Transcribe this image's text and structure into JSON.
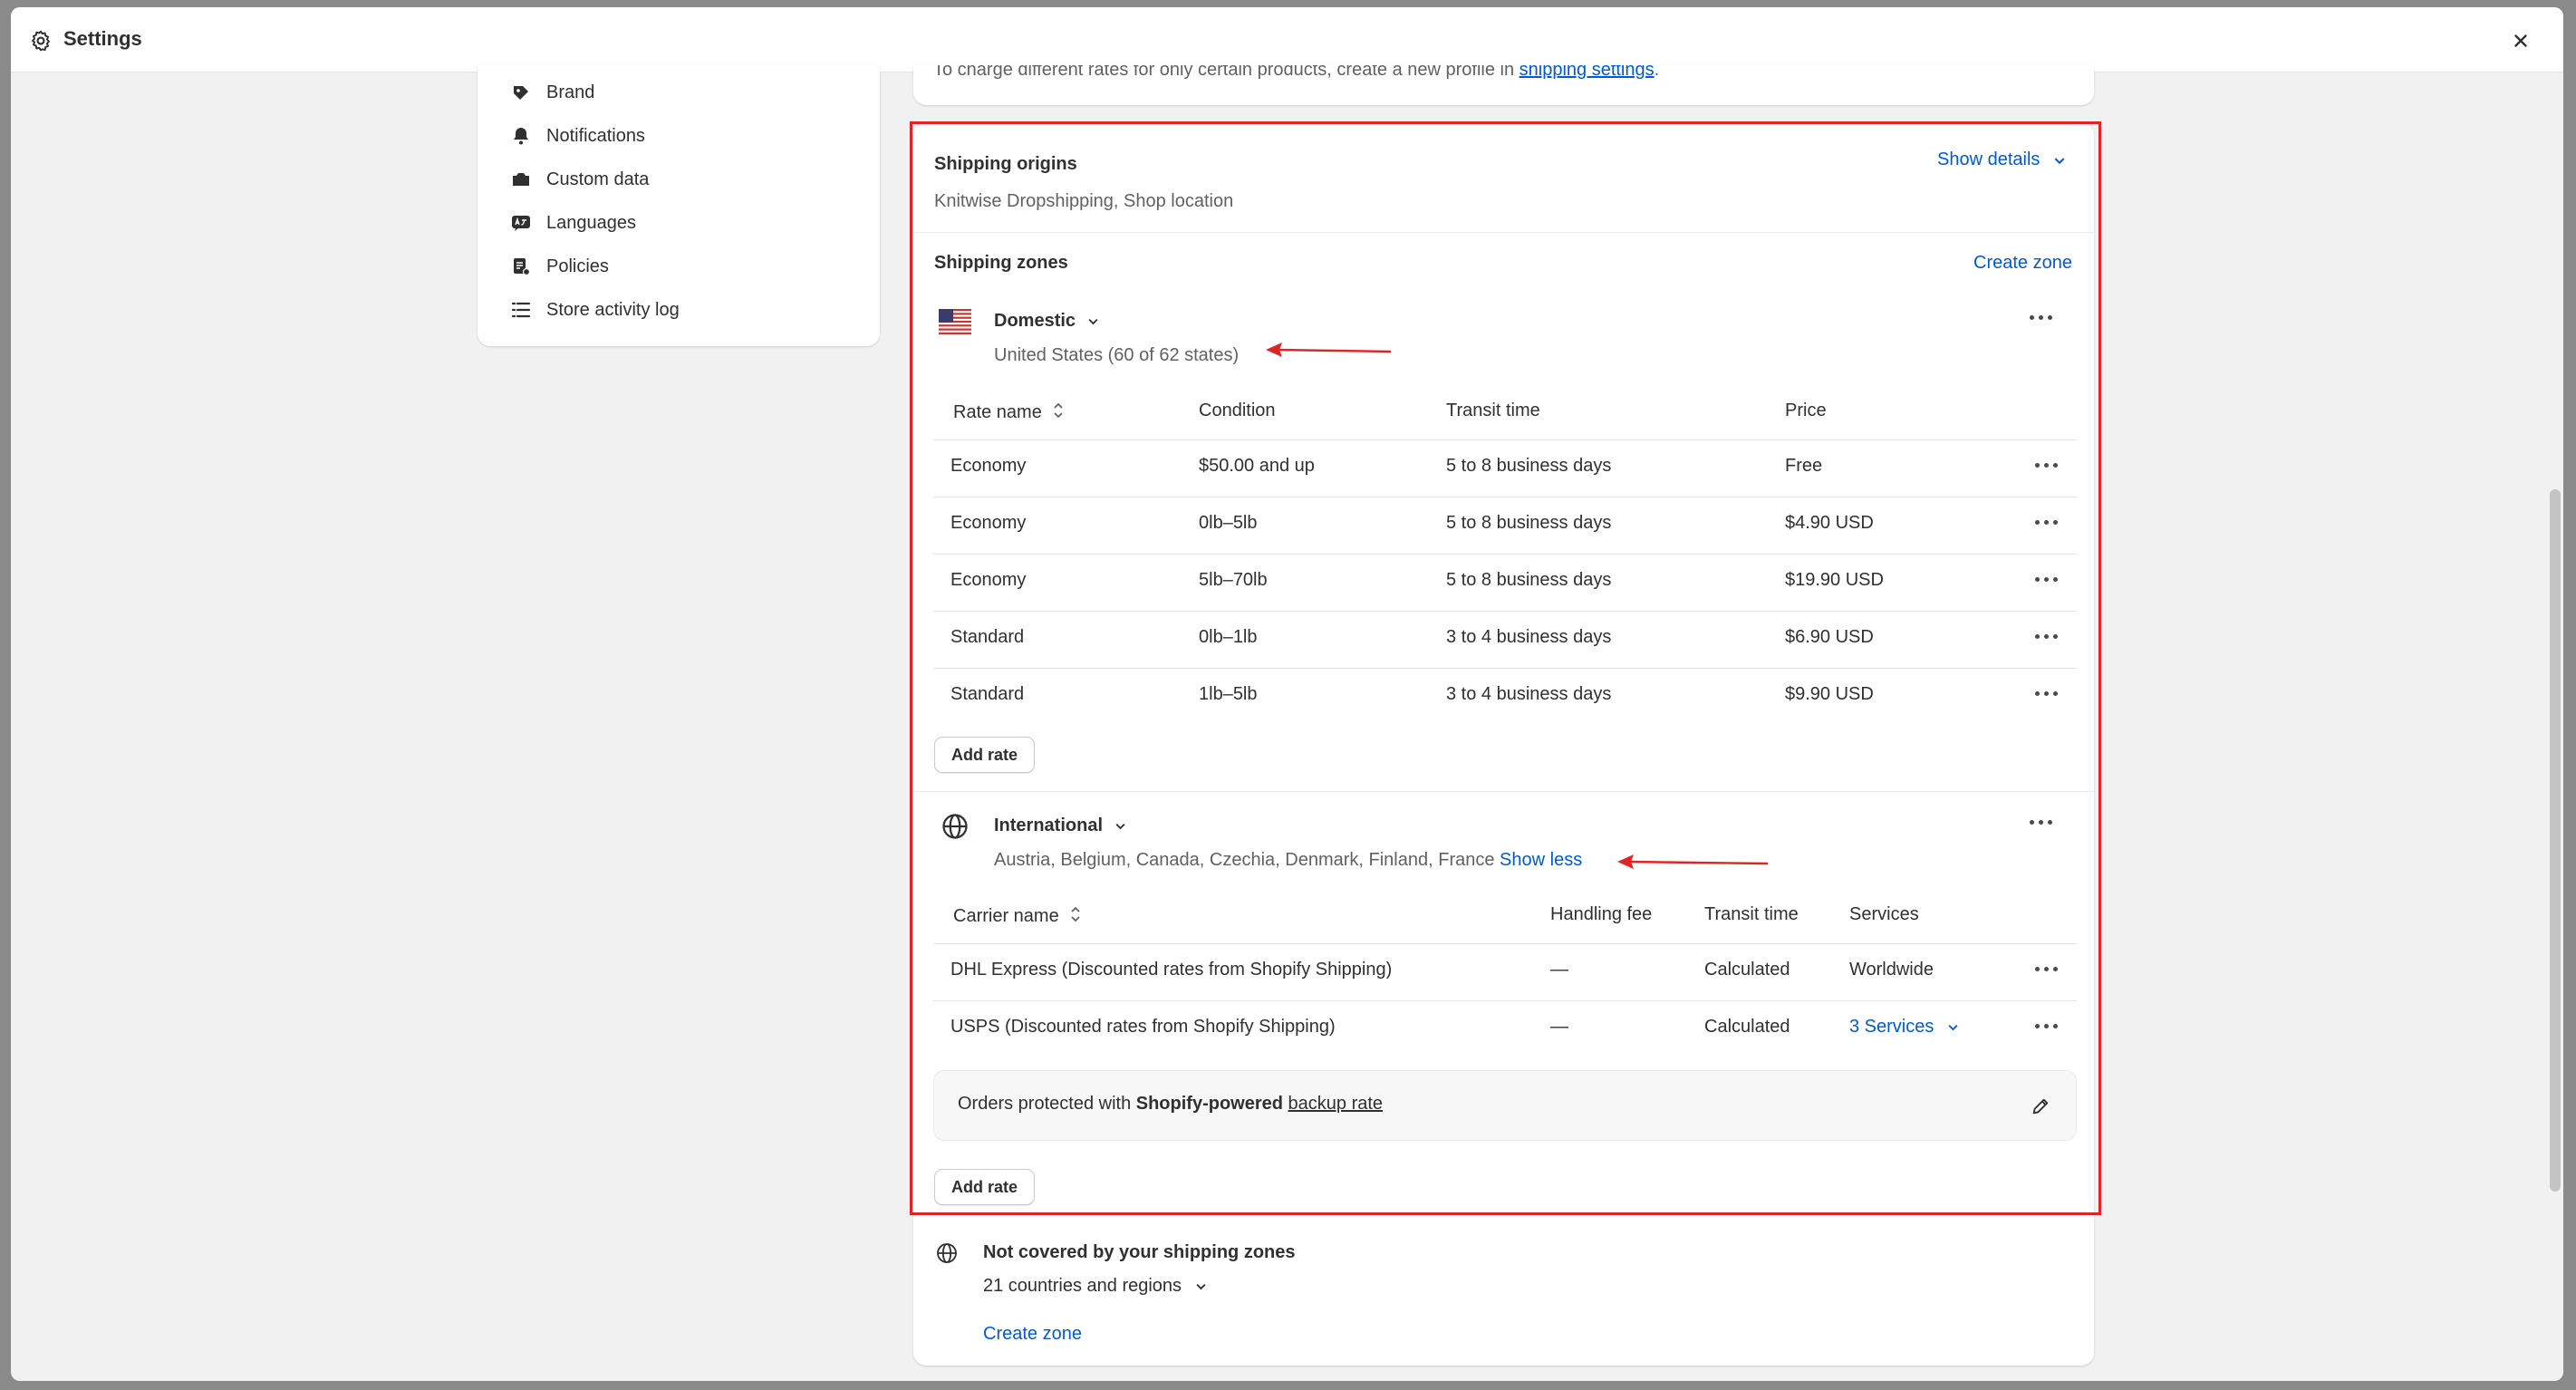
{
  "window": {
    "title": "Settings"
  },
  "sidebar": {
    "items": [
      {
        "label": "Brand",
        "icon": "brand-icon"
      },
      {
        "label": "Notifications",
        "icon": "bell-icon"
      },
      {
        "label": "Custom data",
        "icon": "custom-data-icon"
      },
      {
        "label": "Languages",
        "icon": "languages-icon"
      },
      {
        "label": "Policies",
        "icon": "policies-icon"
      },
      {
        "label": "Store activity log",
        "icon": "list-icon"
      }
    ]
  },
  "top_card": {
    "text": "To charge different rates for only certain products, create a new profile in ",
    "link": "shipping settings",
    "suffix": "."
  },
  "origins": {
    "title": "Shipping origins",
    "show_details": "Show details",
    "value": "Knitwise Dropshipping, Shop location"
  },
  "zones": {
    "title": "Shipping zones",
    "create_zone": "Create zone",
    "domestic": {
      "name": "Domestic",
      "subtitle": "United States (60 of 62 states)",
      "columns": [
        "Rate name",
        "Condition",
        "Transit time",
        "Price"
      ],
      "rows": [
        [
          "Economy",
          "$50.00 and up",
          "5 to 8 business days",
          "Free"
        ],
        [
          "Economy",
          "0lb–5lb",
          "5 to 8 business days",
          "$4.90 USD"
        ],
        [
          "Economy",
          "5lb–70lb",
          "5 to 8 business days",
          "$19.90 USD"
        ],
        [
          "Standard",
          "0lb–1lb",
          "3 to 4 business days",
          "$6.90 USD"
        ],
        [
          "Standard",
          "1lb–5lb",
          "3 to 4 business days",
          "$9.90 USD"
        ]
      ],
      "add_rate": "Add rate"
    },
    "international": {
      "name": "International",
      "subtitle": "Austria, Belgium, Canada, Czechia, Denmark, Finland, France",
      "show_less": "Show less",
      "columns": [
        "Carrier name",
        "Handling fee",
        "Transit time",
        "Services"
      ],
      "rows": [
        [
          "DHL Express (Discounted rates from Shopify Shipping)",
          "—",
          "Calculated",
          "Worldwide"
        ],
        [
          "USPS (Discounted rates from Shopify Shipping)",
          "—",
          "Calculated",
          "3 Services"
        ]
      ],
      "banner": {
        "prefix": "Orders protected with ",
        "bold": "Shopify-powered",
        "link": "backup rate"
      },
      "add_rate": "Add rate"
    }
  },
  "not_covered": {
    "title": "Not covered by your shipping zones",
    "subtitle": "21 countries and regions",
    "create_zone": "Create zone"
  },
  "colors": {
    "accent": "#005bd3",
    "highlight": "#e02424"
  }
}
